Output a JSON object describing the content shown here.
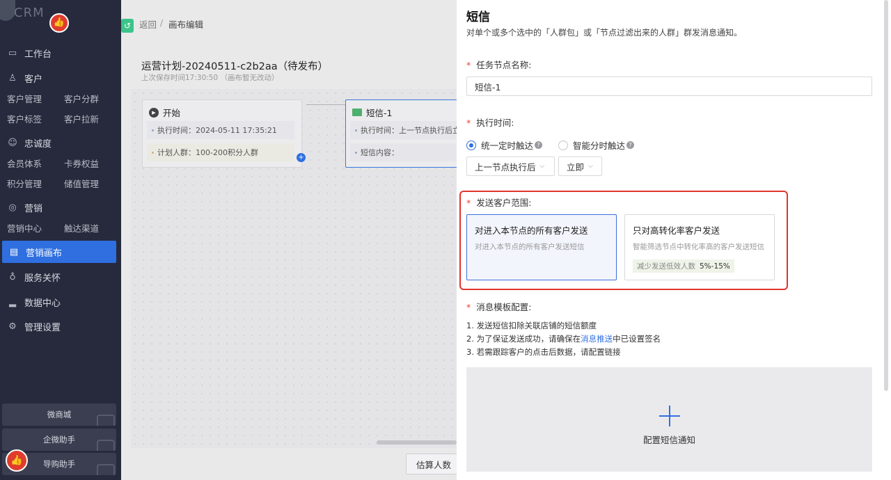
{
  "sidebar": {
    "logo_text": "CRM",
    "badge_icon": "thumbs-up-icon",
    "groups": [
      {
        "label": "工作台",
        "icon": "monitor-icon"
      },
      {
        "label": "客户",
        "icon": "user-icon"
      },
      {
        "label": "忠诚度",
        "icon": "smile-icon"
      },
      {
        "label": "营销",
        "icon": "target-icon"
      },
      {
        "label": "营销画布",
        "icon": "clipboard-icon"
      },
      {
        "label": "服务关怀",
        "icon": "bell-icon"
      },
      {
        "label": "数据中心",
        "icon": "bar-chart-icon"
      },
      {
        "label": "管理设置",
        "icon": "gear-icon"
      }
    ],
    "subs": {
      "customer": [
        "客户管理",
        "客户分群",
        "客户标签",
        "客户拉新"
      ],
      "loyalty": [
        "会员体系",
        "卡券权益",
        "积分管理",
        "储值管理"
      ],
      "marketing": [
        "营销中心",
        "触达渠道"
      ]
    },
    "bottom_buttons": [
      "微商城",
      "企微助手",
      "导购助手"
    ]
  },
  "header": {
    "back": "返回",
    "separator": "/",
    "current": "画布编辑",
    "plan_title": "运营计划-20240511-c2b2aa（待发布）",
    "save_info": "上次保存时间17:30:50 （画布暂无改动）"
  },
  "canvas": {
    "start_node": {
      "title": "开始",
      "row1": "执行时间：2024-05-11 17:35:21",
      "row2": "计划人群：100-200积分人群"
    },
    "sms_node": {
      "title": "短信-1",
      "row1": "执行时间：上一节点执行后立",
      "row2": "短信内容："
    },
    "plus": "+",
    "estimate_button": "估算人数"
  },
  "drawer": {
    "title": "短信",
    "description": "对单个或多个选中的「人群包」或「节点过滤出来的人群」群发消息通知。",
    "required_mark": "*",
    "name_label": "任务节点名称:",
    "name_value": "短信-1",
    "time_label": "执行时间:",
    "radio_fixed": "统一定时触达",
    "radio_smart": "智能分时触达",
    "help": "?",
    "select_after": "上一节点执行后",
    "select_now": "立即",
    "scope_label": "发送客户范围:",
    "card_all": {
      "title": "对进入本节点的所有客户发送",
      "desc": "对进入本节点的所有客户发送短信"
    },
    "card_high": {
      "title": "只对高转化率客户发送",
      "desc": "智能筛选节点中转化率高的客户发送短信",
      "tag_label": "减少发送低效人数",
      "tag_value": "5%-15%"
    },
    "template_label": "消息模板配置:",
    "tips": {
      "line1": "1. 发送短信扣除关联店铺的短信额度",
      "line2_pre": "2. 为了保证发送成功，请确保在",
      "line2_link": "消息推送",
      "line2_post": "中已设置签名",
      "line3": "3. 若需跟踪客户的点击后数据，请配置链接"
    },
    "template_button": "配置短信通知"
  }
}
